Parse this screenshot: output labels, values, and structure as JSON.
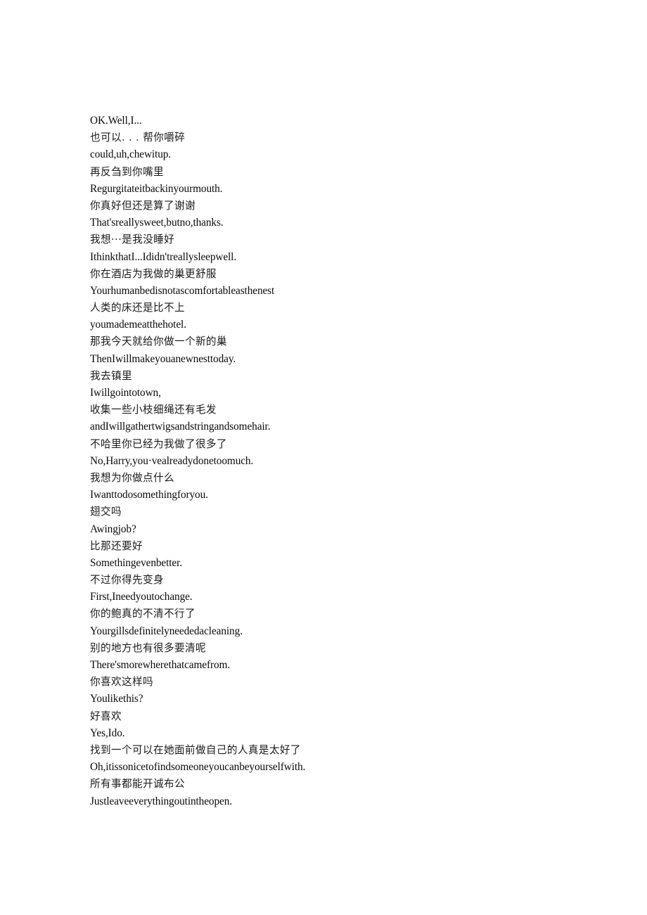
{
  "document": {
    "type": "bilingual-subtitle-transcript",
    "background_color": "#ffffff",
    "text_color": "#0d0d0d",
    "lines": [
      {
        "lang": "en",
        "text": "OK.Well,I..."
      },
      {
        "lang": "zh",
        "text": "也可以. . . 帮你嚼碎"
      },
      {
        "lang": "en",
        "text": "could,uh,chewitup."
      },
      {
        "lang": "zh",
        "text": "再反刍到你嘴里"
      },
      {
        "lang": "en",
        "text": "Regurgitateitbackinyourmouth."
      },
      {
        "lang": "zh",
        "text": "你真好但还是算了谢谢"
      },
      {
        "lang": "en",
        "text": "That'sreallysweet,butno,thanks."
      },
      {
        "lang": "zh",
        "text": "我想···是我没睡好"
      },
      {
        "lang": "en",
        "text": "IthinkthatI...Ididn'treallysleepwell."
      },
      {
        "lang": "zh",
        "text": "你在酒店为我做的巢更舒服"
      },
      {
        "lang": "en",
        "text": "Yourhumanbedisnotascomfortableasthenest"
      },
      {
        "lang": "zh",
        "text": "人类的床还是比不上"
      },
      {
        "lang": "en",
        "text": "youmademeatthehotel."
      },
      {
        "lang": "zh",
        "text": "那我今天就给你做一个新的巢"
      },
      {
        "lang": "en",
        "text": "ThenIwillmakeyouanewnesttoday."
      },
      {
        "lang": "zh",
        "text": "我去镇里"
      },
      {
        "lang": "en",
        "text": "Iwillgointotown,"
      },
      {
        "lang": "zh",
        "text": "收集一些小枝细绳还有毛发"
      },
      {
        "lang": "en",
        "text": "andIwillgathertwigsandstringandsomehair."
      },
      {
        "lang": "zh",
        "text": "不哈里你已经为我做了很多了"
      },
      {
        "lang": "en",
        "text": "No,Harry,you·vealreadydonetoomuch."
      },
      {
        "lang": "zh",
        "text": "我想为你做点什么"
      },
      {
        "lang": "en",
        "text": "Iwanttodosomethingforyou."
      },
      {
        "lang": "zh",
        "text": "翅交吗"
      },
      {
        "lang": "en",
        "text": "Awingjob?"
      },
      {
        "lang": "zh",
        "text": "比那还要好"
      },
      {
        "lang": "en",
        "text": "Somethingevenbetter."
      },
      {
        "lang": "zh",
        "text": "不过你得先变身"
      },
      {
        "lang": "en",
        "text": "First,Ineedyoutochange."
      },
      {
        "lang": "zh",
        "text": "你的鲍真的不清不行了"
      },
      {
        "lang": "en",
        "text": "Yourgillsdefinitelyneededacleaning."
      },
      {
        "lang": "zh",
        "text": "别的地方也有很多要清呢"
      },
      {
        "lang": "en",
        "text": "There'smorewherethatcamefrom."
      },
      {
        "lang": "zh",
        "text": "你喜欢这样吗"
      },
      {
        "lang": "en",
        "text": "Youlikethis?"
      },
      {
        "lang": "zh",
        "text": "好喜欢"
      },
      {
        "lang": "en",
        "text": "Yes,Ido."
      },
      {
        "lang": "zh",
        "text": "找到一个可以在她面前做自己的人真是太好了"
      },
      {
        "lang": "en",
        "text": "Oh,itissonicetofindsomeoneyoucanbeyourselfwith."
      },
      {
        "lang": "zh",
        "text": "所有事都能开诚布公"
      },
      {
        "lang": "en",
        "text": "Justleaveeverythingoutintheopen."
      }
    ]
  }
}
